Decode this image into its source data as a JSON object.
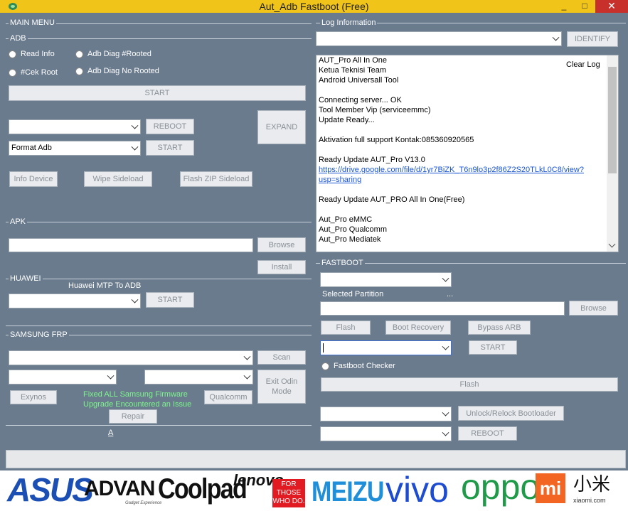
{
  "window": {
    "title": "Aut_Adb Fastboot (Free)",
    "minimize": "_",
    "maximize": "□",
    "close": "✕"
  },
  "main_menu": {
    "label": "MAIN MENU"
  },
  "adb": {
    "label": "ADB",
    "radios": [
      "Read Info",
      "Adb Diag #Rooted",
      "#Cek Root",
      "Adb Diag No Rooted"
    ],
    "start": "START",
    "reboot": "REBOOT",
    "expand": "EXPAND",
    "combo1_value": "",
    "combo2_value": "Format Adb",
    "start2": "START",
    "info_device": "Info Device",
    "wipe_sideload": "Wipe Sideload",
    "flash_zip": "Flash ZIP Sideload"
  },
  "apk": {
    "label": "APK",
    "browse": "Browse",
    "install": "Install"
  },
  "huawei": {
    "label": "HUAWEI",
    "subtitle": "Huawei MTP To ADB",
    "start": "START"
  },
  "samsung": {
    "label": "SAMSUNG FRP",
    "scan": "Scan",
    "exit_odin": "Exit Odin Mode",
    "exynos": "Exynos",
    "qualcomm": "Qualcomm",
    "repair": "Repair",
    "note1": "Fixed ALL Samsung  Firmware",
    "note2": "Upgrade Encountered an Issue",
    "link_a": "A"
  },
  "log": {
    "label": "Log Information",
    "identify": "IDENTIFY",
    "clear_log": "Clear Log",
    "lines": [
      "AUT_Pro All In One",
      "Ketua Teknisi Team",
      " Android Universall Tool",
      "",
      "Connecting server... OK",
      "Tool Member Vip (serviceemmc)",
      "Update Ready...",
      "",
      "Aktivation full support Kontak:085360920565",
      "",
      "Ready Update AUT_Pro V13.0",
      "https://drive.google.com/file/d/1yr7BiZK_T6n9lo3p2f86Z2S20TLkL0C8/view?",
      "usp=sharing",
      "",
      "Ready Update AUT_PRO All In One(Free)",
      "",
      "Aut_Pro eMMC",
      "Aut_Pro Qualcomm",
      "Aut_Pro Mediatek"
    ]
  },
  "fastboot": {
    "label": "FASTBOOT",
    "selected_partition": "Selected Partition",
    "dots": "...",
    "browse": "Browse",
    "flash": "Flash",
    "boot_recovery": "Boot Recovery",
    "bypass_arb": "Bypass ARB",
    "start": "START",
    "checker": "Fastboot Checker",
    "flash2": "Flash",
    "unlock": "Unlock/Relock Bootloader",
    "reboot": "REBOOT"
  },
  "brands": {
    "asus": "ASUS",
    "advan": "ADVAN",
    "advan_tag": "Gadget Experience",
    "coolpad": "Coolpad",
    "lenovo": "lenovo",
    "lenovo_tag": "FOR THOSE WHO DO.",
    "meizu": "MEIZU",
    "vivo": "vivo",
    "oppo": "oppo",
    "mi": "mi",
    "xiaomi_cn": "小米",
    "xiaomi_url": "xiaomi.com"
  },
  "colors": {
    "panel": "#6a7b8d",
    "title_bar": "#f0c419",
    "close": "#c7302b",
    "note": "#7cf58a",
    "link": "#1a55d6"
  }
}
